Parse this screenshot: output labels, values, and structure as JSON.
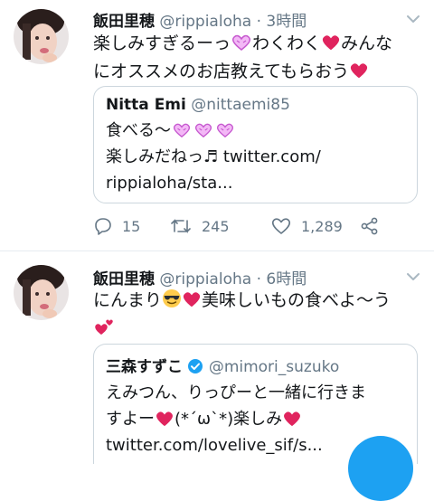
{
  "tweets": [
    {
      "name": "飯田里穂",
      "handle": "@rippialoha",
      "dot": "·",
      "time": "3時間",
      "text_parts": [
        "楽しみすぎるーっ",
        "わくわく",
        "みんな",
        "にオススメのお店教えてもらおう"
      ],
      "quote": {
        "name": "Nitta Emi",
        "handle": "@nittaemi85",
        "line1": "食べる〜",
        "line2": "楽しみだねっ♬ twitter.com/",
        "line3": "rippialoha/sta..."
      },
      "actions": {
        "replies": "15",
        "retweets": "245",
        "likes": "1,289"
      }
    },
    {
      "name": "飯田里穂",
      "handle": "@rippialoha",
      "dot": "·",
      "time": "6時間",
      "text_parts": [
        "にんまり",
        "美味しいもの食べよ〜う"
      ],
      "quote": {
        "name": "三森すずこ",
        "handle": "@mimori_suzuko",
        "line1_a": "えみつん、りっぴーと一緒に行きま",
        "line2_a": "すよー",
        "line2_b": "(*´ω`*)楽しみ",
        "line3": "twitter.com/lovelive_sif/s..."
      }
    }
  ],
  "colors": {
    "accent": "#1da1f2",
    "heart": "#e0245e",
    "muted": "#657786",
    "border": "#ccd6dd"
  },
  "icons": [
    "avatar",
    "chevron-down-icon",
    "purple-heart-icon",
    "red-heart-icon",
    "sunglasses-emoji-icon",
    "reply-icon",
    "retweet-icon",
    "like-icon",
    "share-icon",
    "verified-badge-icon",
    "compose-fab"
  ]
}
